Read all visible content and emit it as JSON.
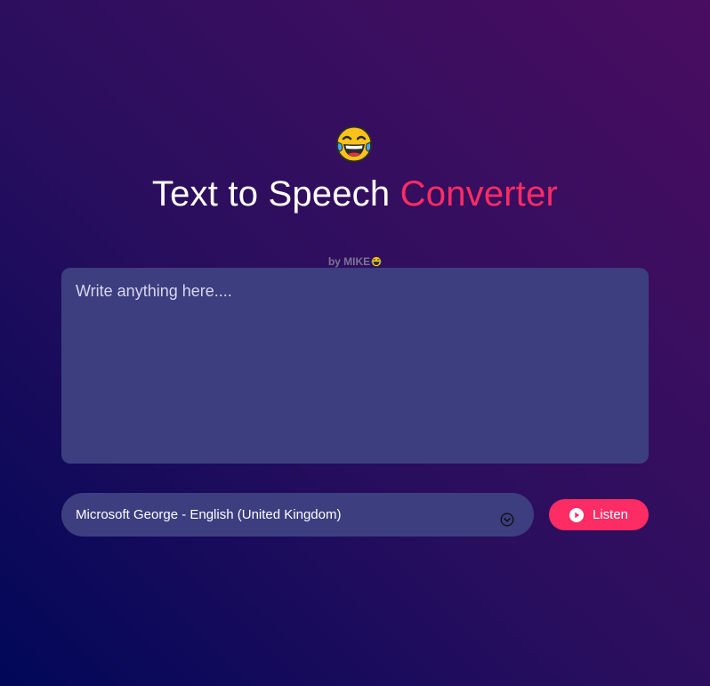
{
  "header": {
    "emoji_icon": "face-with-tears-of-joy-icon",
    "title_main": "Text to Speech",
    "title_accent": "Converter",
    "byline": "by MIKE"
  },
  "editor": {
    "placeholder": "Write anything here....",
    "value": ""
  },
  "voice_select": {
    "selected": "Microsoft George - English (United Kingdom)",
    "arrow_icon": "chevron-down-circle-icon"
  },
  "listen_button": {
    "label": "Listen",
    "icon": "play-circle-icon"
  },
  "colors": {
    "accent": "#fe2c64",
    "panel": "#3d3e80",
    "bg_start": "#010758",
    "bg_end": "#490d61"
  }
}
